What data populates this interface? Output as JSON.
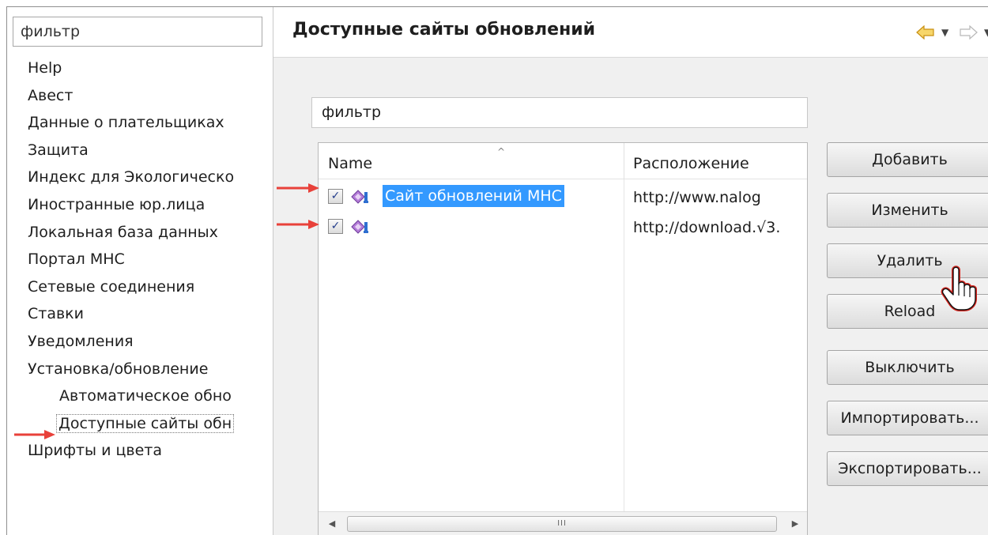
{
  "sidebar": {
    "filter_value": "фильтр",
    "items": [
      {
        "label": "Help"
      },
      {
        "label": "Авест"
      },
      {
        "label": "Данные о плательщиках"
      },
      {
        "label": "Защита"
      },
      {
        "label": "Индекс для Экологическо"
      },
      {
        "label": "Иностранные юр.лица"
      },
      {
        "label": "Локальная база данных"
      },
      {
        "label": "Портал МНС"
      },
      {
        "label": "Сетевые соединения"
      },
      {
        "label": "Ставки"
      },
      {
        "label": "Уведомления"
      },
      {
        "label": "Установка/обновление"
      },
      {
        "label": "Автоматическое обно"
      },
      {
        "label": "Доступные сайты обн"
      },
      {
        "label": "Шрифты и цвета"
      }
    ]
  },
  "main": {
    "title": "Доступные сайты обновлений",
    "filter_value": "фильтр",
    "table": {
      "columns": [
        "Name",
        "Расположение"
      ],
      "rows": [
        {
          "checked": "✓",
          "name": "Сайт обновлений МНС",
          "location": "http://www.nalog"
        },
        {
          "checked": "✓",
          "name": "",
          "location": "http://download.√3."
        }
      ],
      "scroll_thumb": "III"
    },
    "buttons": {
      "add": "Добавить",
      "edit": "Изменить",
      "delete": "Удалить",
      "reload": "Reload",
      "disable": "Выключить",
      "import": "Импортировать...",
      "export": "Экспортировать..."
    }
  },
  "colors": {
    "selection": "#3399ff",
    "annotation_arrow": "#e8413a",
    "nav_arrow": "#f2b630"
  }
}
